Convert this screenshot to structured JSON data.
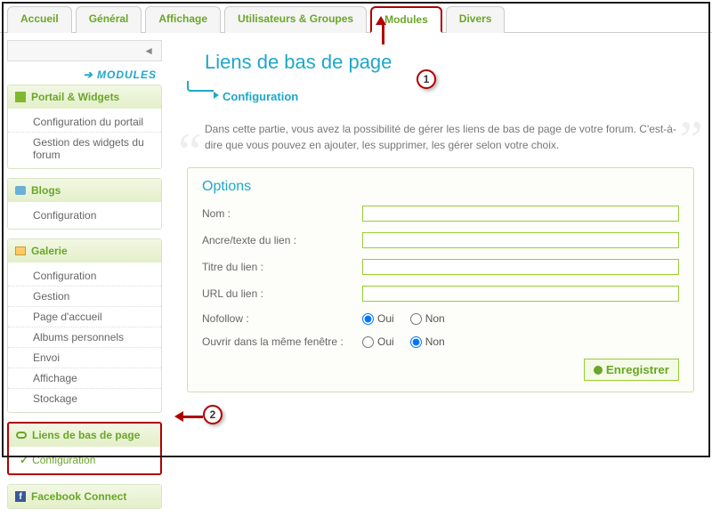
{
  "tabs": [
    "Accueil",
    "Général",
    "Affichage",
    "Utilisateurs & Groupes",
    "Modules",
    "Divers"
  ],
  "active_tab_index": 4,
  "annotations": {
    "n1": "1",
    "n2": "2"
  },
  "sidebar": {
    "back_glyph": "◄",
    "top_arrow": "➔",
    "top_title": "MODULES",
    "sections": [
      {
        "title": "Portail & Widgets",
        "icon": "block",
        "items": [
          "Configuration du portail",
          "Gestion des widgets du forum"
        ]
      },
      {
        "title": "Blogs",
        "icon": "chat",
        "items": [
          "Configuration"
        ]
      },
      {
        "title": "Galerie",
        "icon": "gallery",
        "items": [
          "Configuration",
          "Gestion",
          "Page d'accueil",
          "Albums personnels",
          "Envoi",
          "Affichage",
          "Stockage"
        ]
      },
      {
        "title": "Liens de bas de page",
        "icon": "link",
        "items": [
          "Configuration"
        ],
        "highlighted": true,
        "active_item": 0
      },
      {
        "title": "Facebook Connect",
        "icon": "fb",
        "items": []
      }
    ]
  },
  "main": {
    "title": "Liens de bas de page",
    "subtitle": "Configuration",
    "description": "Dans cette partie, vous avez la possibilité de gérer les liens de bas de page de votre forum. C'est-à-dire que vous pouvez en ajouter, les supprimer, les gérer selon votre choix.",
    "options_title": "Options",
    "fields": {
      "name_label": "Nom :",
      "anchor_label": "Ancre/texte du lien :",
      "title_label": "Titre du lien :",
      "url_label": "URL du lien :",
      "nofollow_label": "Nofollow :",
      "samewin_label": "Ouvrir dans la même fenêtre :",
      "oui": "Oui",
      "non": "Non",
      "nofollow_value": "Oui",
      "samewin_value": "Non",
      "name_value": "",
      "anchor_value": "",
      "title_value": "",
      "url_value": ""
    },
    "save_label": "Enregistrer"
  }
}
